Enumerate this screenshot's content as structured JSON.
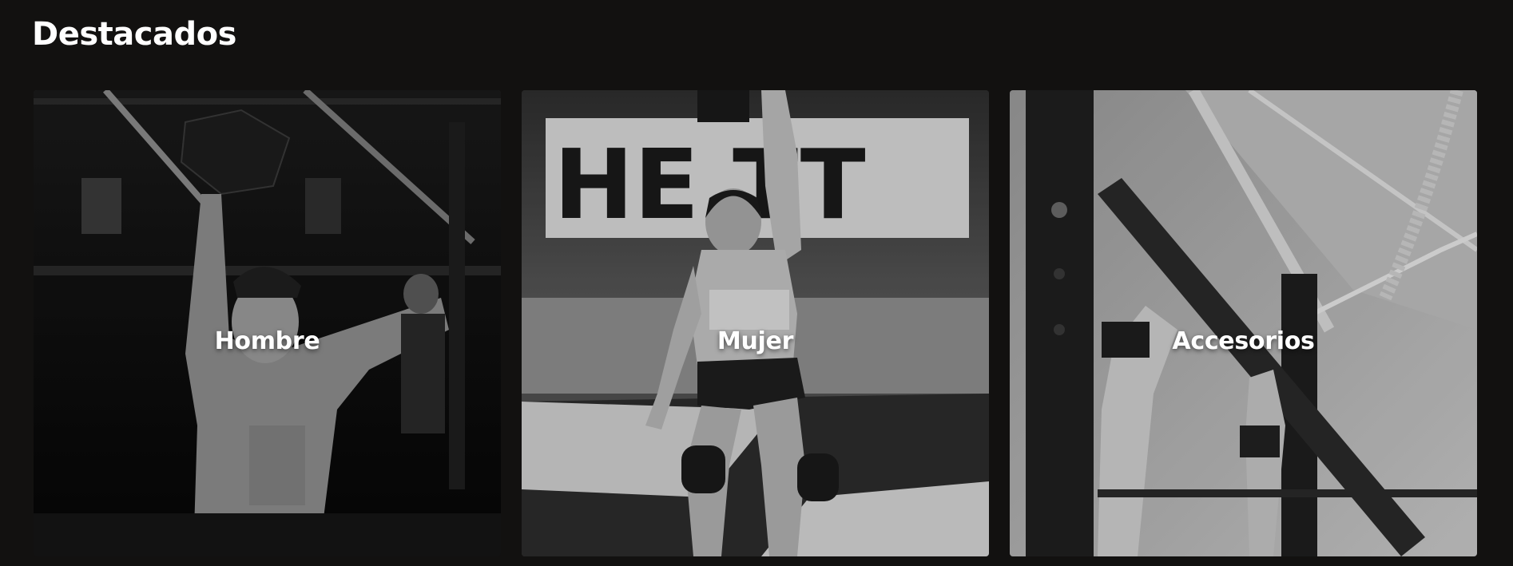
{
  "section": {
    "title": "Destacados"
  },
  "cards": [
    {
      "label": "Hombre"
    },
    {
      "label": "Mujer"
    },
    {
      "label": "Accesorios"
    }
  ],
  "colors": {
    "background": "#121110",
    "text": "#ffffff"
  }
}
